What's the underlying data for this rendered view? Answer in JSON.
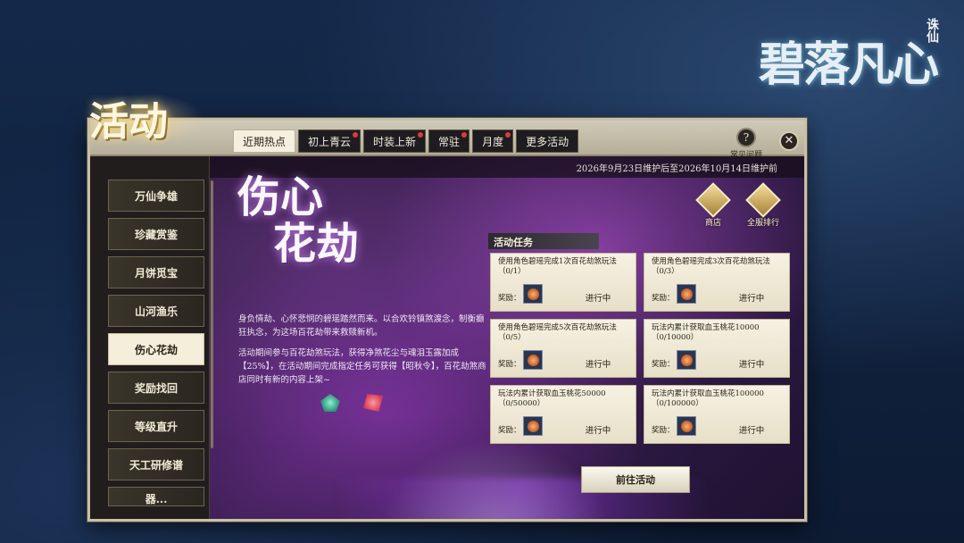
{
  "logo": {
    "text": "碧落凡心",
    "tag": "诛仙"
  },
  "activity_title": "活动",
  "tabs": [
    {
      "label": "近期热点",
      "active": true,
      "dot": false
    },
    {
      "label": "初上青云",
      "active": false,
      "dot": true
    },
    {
      "label": "时装上新",
      "active": false,
      "dot": true
    },
    {
      "label": "常驻",
      "active": false,
      "dot": true
    },
    {
      "label": "月度",
      "active": false,
      "dot": true
    },
    {
      "label": "更多活动",
      "active": false,
      "dot": false
    }
  ],
  "faq": {
    "label": "常见问题",
    "icon": "question-icon"
  },
  "close_icon": "✕",
  "maintenance": "2026年9月23日维护后至2026年10月14日维护前",
  "sidebar": {
    "items": [
      {
        "label": "万仙争雄"
      },
      {
        "label": "珍藏赏鉴"
      },
      {
        "label": "月饼觅宝"
      },
      {
        "label": "山河渔乐"
      },
      {
        "label": "伤心花劫",
        "active": true
      },
      {
        "label": "奖励找回"
      },
      {
        "label": "等级直升"
      },
      {
        "label": "天工研修谱"
      },
      {
        "label": "器..."
      }
    ]
  },
  "event": {
    "title_line1": "伤心",
    "title_line2": "花劫",
    "desc1": "身负情劫、心怀悲悯的碧瑶踏然而来。以合欢铃镇煞渡念，制衡癫狂执念，为这场百花劫带来救赎新机。",
    "desc2": "活动期间参与百花劫煞玩法，获得净煞花尘与魂泪玉露加成【25%】，在活动期间完成指定任务可获得【昭秋令】，百花劫煞商店同时有新的内容上架~"
  },
  "shop": {
    "label": "商店"
  },
  "rank": {
    "label": "全服排行"
  },
  "tasks_header": "活动任务",
  "tasks": [
    {
      "desc": "使用角色碧瑶完成1次百花劫煞玩法（0/1）",
      "reward_label": "奖励：",
      "status": "进行中"
    },
    {
      "desc": "使用角色碧瑶完成3次百花劫煞玩法（0/3）",
      "reward_label": "奖励：",
      "status": "进行中"
    },
    {
      "desc": "使用角色碧瑶完成5次百花劫煞玩法（0/5）",
      "reward_label": "奖励：",
      "status": "进行中"
    },
    {
      "desc": "玩法内累计获取血玉桃花10000（0/10000）",
      "reward_label": "奖励：",
      "status": "进行中"
    },
    {
      "desc": "玩法内累计获取血玉桃花50000（0/50000）",
      "reward_label": "奖励：",
      "status": "进行中"
    },
    {
      "desc": "玩法内累计获取血玉桃花100000（0/100000）",
      "reward_label": "奖励：",
      "status": "进行中"
    }
  ],
  "goto_button": "前往活动"
}
